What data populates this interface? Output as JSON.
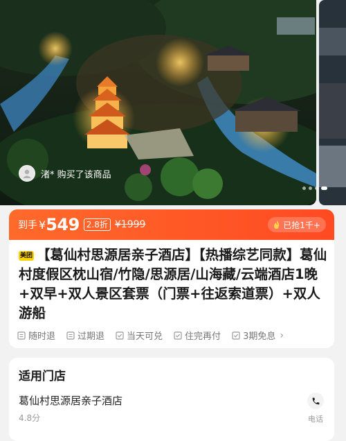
{
  "hero": {
    "buyer_text": "渚* 购买了该商品",
    "slide_count": 4,
    "active_slide": 4
  },
  "price": {
    "prefix": "到手",
    "currency": "¥",
    "amount": "549",
    "discount": "2.8折",
    "original": "¥1999",
    "sold": "已抢1千+"
  },
  "product": {
    "brand_tag": "美团",
    "title": "【葛仙村思源居亲子酒店】【热播综艺同款】葛仙村度假区枕山宿/竹隐/思源居/山海藏/云端酒店1晚+双早+双人景区套票（门票+往返索道票）+双人游船",
    "services": [
      {
        "label": "随时退",
        "icon": "doc-icon"
      },
      {
        "label": "过期退",
        "icon": "doc-icon"
      },
      {
        "label": "当天可兑",
        "icon": "check-icon"
      },
      {
        "label": "住完再付",
        "icon": "check-icon"
      },
      {
        "label": "3期免息",
        "icon": "check-icon"
      }
    ]
  },
  "store": {
    "heading": "适用门店",
    "name": "葛仙村思源居亲子酒店",
    "rating": "4.8分",
    "phone_label": "电话"
  },
  "colors": {
    "accent": "#ff4a22",
    "brand_yellow": "#ffd100"
  }
}
